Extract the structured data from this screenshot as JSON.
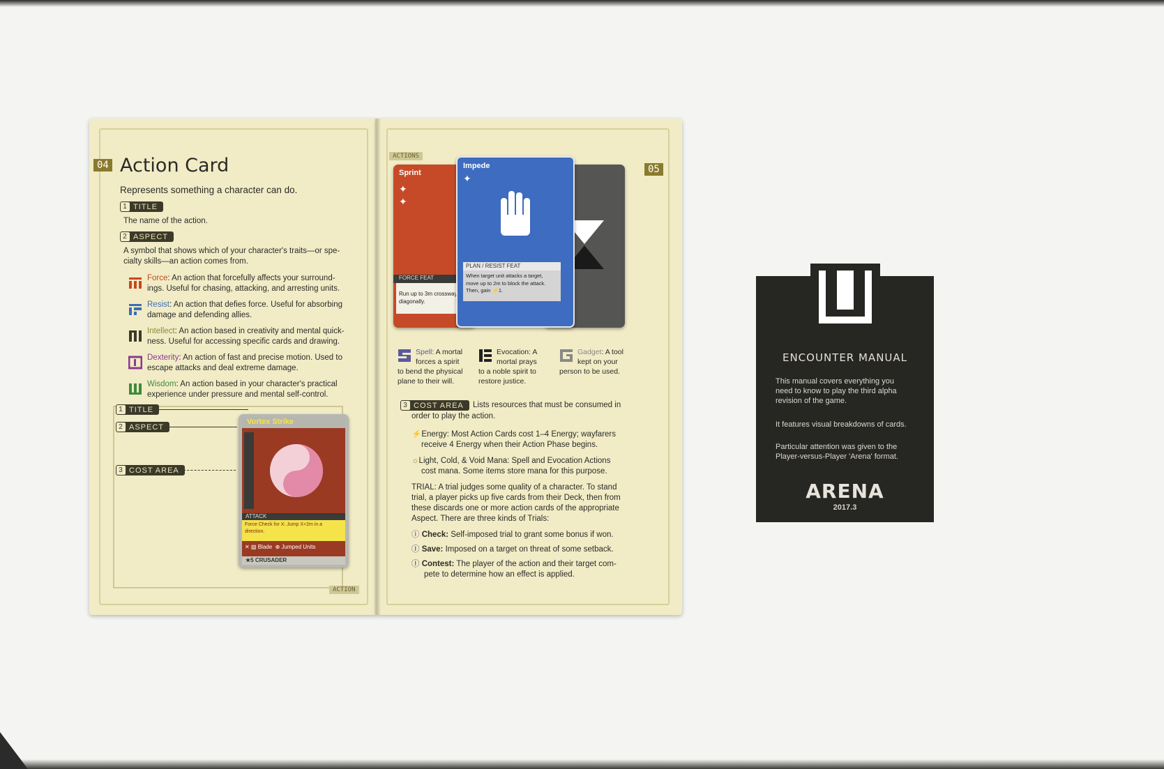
{
  "left_page": {
    "page_number": "04",
    "heading": "Action Card",
    "subtitle": "Represents something a character can do.",
    "title_label": {
      "num": "1",
      "text": "TITLE"
    },
    "title_desc": "The name of the action.",
    "aspect_label": {
      "num": "2",
      "text": "ASPECT"
    },
    "aspect_desc_1": "A symbol that shows which of your character's traits—or spe-",
    "aspect_desc_2": "cialty skills—an action comes from.",
    "aspects": [
      {
        "name": "Force",
        "color": "#c8471e",
        "line1": ": An action that forcefully affects your surround-",
        "line2": "ings. Useful for chasing, attacking, and arresting units."
      },
      {
        "name": "Resist",
        "color": "#3b6db5",
        "line1": ": An action that defies force. Useful for absorbing",
        "line2": "damage and defending allies."
      },
      {
        "name": "Intellect",
        "color": "#8a8a38",
        "line1": ": An action based in creativity and mental quick-",
        "line2": "ness. Useful for accessing specific cards and drawing."
      },
      {
        "name": "Dexterity",
        "color": "#8b3a8e",
        "line1": ": An action of fast and precise motion. Used to",
        "line2": "escape attacks and deal extreme damage."
      },
      {
        "name": "Wisdom",
        "color": "#3e8a3a",
        "line1": ": An action based in your character's practical",
        "line2": "experience under pressure and mental self-control."
      }
    ],
    "callouts": [
      {
        "num": "1",
        "text": "TITLE"
      },
      {
        "num": "2",
        "text": "ASPECT"
      },
      {
        "num": "3",
        "text": "COST AREA"
      }
    ],
    "sample_card": {
      "title": "Vortex Strike",
      "type": "ATTACK",
      "check": "Force Check for X: Jump X+2m in a",
      "check2": "direction.",
      "tag1": "Blade",
      "tag2": "Jumped Units",
      "footer": "CRUSADER"
    },
    "corner_tag": "ACTION"
  },
  "right_page": {
    "page_number": "05",
    "corner_tag": "ACTIONS",
    "cards": {
      "sprint": {
        "title": "Sprint",
        "type": "FORCE FEAT",
        "text1": "Run up to 3m crossways",
        "text2": "diagonally."
      },
      "impede": {
        "title": "Impede",
        "type": "PLAN / RESIST FEAT",
        "text1": "When target unit attacks a target,",
        "text2": "move up to 2m to block the attack.",
        "text3": "Then, gain ⚡1."
      }
    },
    "types": [
      {
        "name": "Spell",
        "l1": ": A mortal",
        "l2": "forces a spirit",
        "l3": "to bend the physical",
        "l4": "plane to their will."
      },
      {
        "name": "Evocation",
        "l1": ": A",
        "l2": "mortal prays",
        "l3": "to a noble spirit to",
        "l4": "restore justice."
      },
      {
        "name": "Gadget",
        "l1": ": A tool",
        "l2": "kept on your",
        "l3": "person to be used.",
        "l4": ""
      }
    ],
    "cost_label": {
      "num": "3",
      "text": "COST AREA"
    },
    "cost_desc_1": "Lists resources that must be consumed in",
    "cost_desc_2": "order to play the action.",
    "energy_1": "Energy: Most Action Cards cost 1–4 Energy; wayfarers",
    "energy_2": "receive 4 Energy when their Action Phase begins.",
    "mana_1": "Light,  Cold, &  Void Mana: Spell and Evocation Actions",
    "mana_2": "cost mana. Some items store mana for this purpose.",
    "trial_1": "TRIAL: A trial judges some quality of a character. To stand",
    "trial_2": "trial, a player picks up five cards from their Deck, then from",
    "trial_3": "these discards one or more action cards of the appropriate",
    "trial_4": "Aspect. There are three kinds of Trials:",
    "trials": [
      {
        "name": "Check:",
        "l1": " Self-imposed trial to grant some bonus if won.",
        "l2": ""
      },
      {
        "name": "Save:",
        "l1": " Imposed on a target on threat of some setback.",
        "l2": ""
      },
      {
        "name": "Contest:",
        "l1": " The player of the action and their target com-",
        "l2": "pete to determine how an effect is applied."
      }
    ]
  },
  "manual": {
    "title": "ENCOUNTER MANUAL",
    "p1_1": "This manual covers everything you",
    "p1_2": "need to know to play the third alpha",
    "p1_3": "revision of the game.",
    "p2": "It features visual breakdowns of cards.",
    "p3_1": "Particular attention was given to the",
    "p3_2": "Player-versus-Player 'Arena' format.",
    "logo": "ARENA",
    "version": "2017.3"
  }
}
